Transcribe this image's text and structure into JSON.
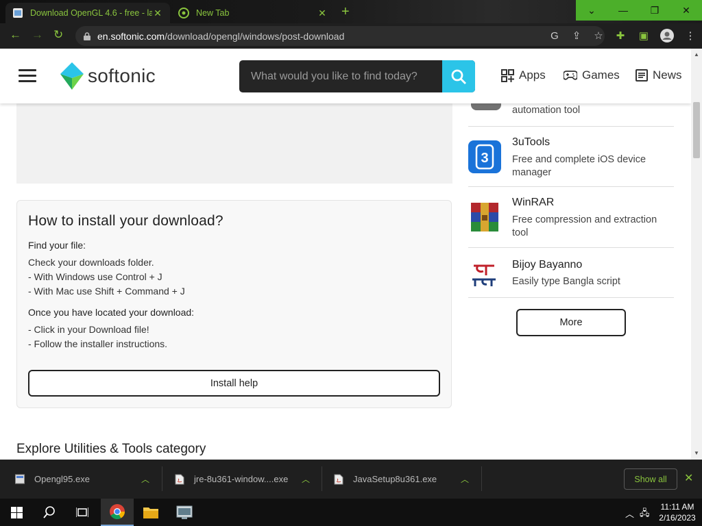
{
  "browser": {
    "tabs": [
      {
        "title": "Download OpenGL 4.6 - free - la",
        "active": true
      },
      {
        "title": "New Tab",
        "active": false
      }
    ],
    "url_domain": "en.softonic.com",
    "url_path": "/download/opengl/windows/post-download"
  },
  "site": {
    "logo_text": "softonic",
    "search_placeholder": "What would you like to find today?",
    "nav": [
      {
        "label": "Apps",
        "icon": "apps-grid-icon"
      },
      {
        "label": "Games",
        "icon": "gamepad-icon"
      },
      {
        "label": "News",
        "icon": "newspaper-icon"
      }
    ]
  },
  "install": {
    "heading": "How to install your download?",
    "find_label": "Find your file:",
    "find_lines": [
      "Check your downloads folder.",
      "- With Windows use Control + J",
      "- With Mac use Shift + Command + J"
    ],
    "located_label": "Once you have located your download:",
    "located_lines": [
      "- Click in your Download file!",
      "- Follow the installer instructions."
    ],
    "button": "Install help"
  },
  "explore_heading": "Explore Utilities & Tools category",
  "sidebar": {
    "items": [
      {
        "name": "",
        "desc": "automation tool"
      },
      {
        "name": "3uTools",
        "desc": "Free and complete iOS device manager"
      },
      {
        "name": "WinRAR",
        "desc": "Free compression and extraction tool"
      },
      {
        "name": "Bijoy Bayanno",
        "desc": "Easily type Bangla script"
      }
    ],
    "more_button": "More"
  },
  "downloads": {
    "files": [
      "Opengl95.exe",
      "jre-8u361-window....exe",
      "JavaSetup8u361.exe"
    ],
    "show_all": "Show all"
  },
  "taskbar": {
    "time": "11:11 AM",
    "date": "2/16/2023"
  },
  "colors": {
    "accent_green": "#8ac53e",
    "search_button": "#2bc4e8",
    "window_controls": "#4caf2a"
  }
}
